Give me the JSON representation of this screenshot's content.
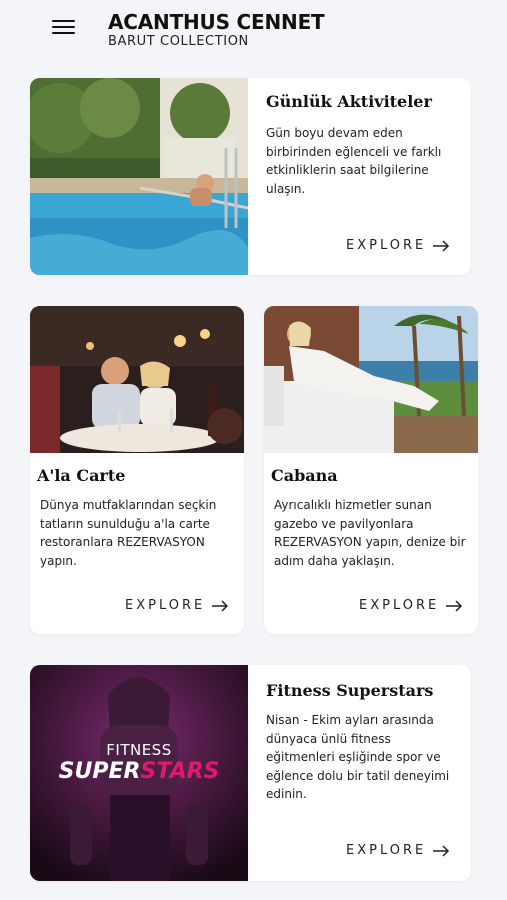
{
  "header": {
    "menu_icon": "hamburger-menu-icon",
    "title": "ACANTHUS CENNET",
    "subtitle": "BARUT COLLECTION"
  },
  "cards": [
    {
      "title": "Günlük Aktiviteler",
      "description": "Gün boyu devam eden birbirinden eğlenceli ve farklı etkinliklerin saat bilgilerine ulaşın.",
      "cta": "EXPLORE"
    },
    {
      "title": "A'la Carte",
      "description": "Dünya mutfaklarından seçkin tatların sunulduğu a'la carte restoranlara REZERVASYON yapın.",
      "cta": "EXPLORE"
    },
    {
      "title": "Cabana",
      "description": "Ayrıcalıklı hizmetler sunan gazebo ve pavilyonlara REZERVASYON yapın, denize bir adım daha yaklaşın.",
      "cta": "EXPLORE"
    },
    {
      "title": "Fitness Superstars",
      "description": "Nisan - Ekim ayları arasında dünyaca ünlü fitness eğitmenleri eşliğinde spor ve eğlence dolu bir tatil deneyimi edinin.",
      "cta": "EXPLORE",
      "image_text": {
        "line1": "FITNESS",
        "line2a": "SUPER",
        "line2b": "STARS"
      }
    }
  ],
  "colors": {
    "background": "#f4f5f9",
    "card": "#ffffff",
    "fitness_pink": "#e0196e"
  }
}
